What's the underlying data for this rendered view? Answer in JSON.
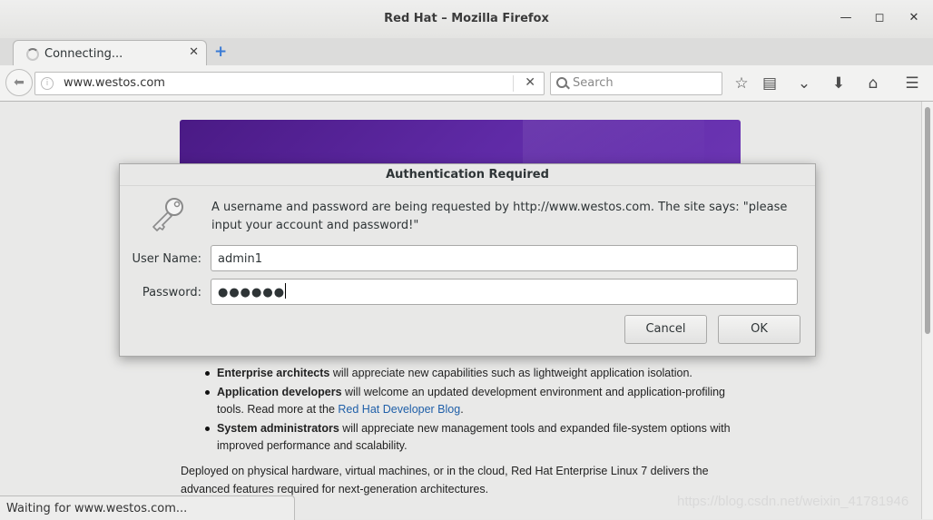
{
  "window": {
    "title": "Red Hat – Mozilla Firefox"
  },
  "tab": {
    "label": "Connecting..."
  },
  "navbar": {
    "url": "www.westos.com",
    "search_placeholder": "Search"
  },
  "page": {
    "items": [
      {
        "bold": "Enterprise architects",
        "text": " will appreciate new capabilities such as lightweight application isolation."
      },
      {
        "bold": "Application developers",
        "text": " will welcome an updated development environment and application-profiling tools. Read more at the ",
        "link": "Red Hat Developer Blog",
        "after": "."
      },
      {
        "bold": "System administrators",
        "text": " will appreciate new management tools and expanded file-system options with improved performance and scalability."
      }
    ],
    "paragraph": "Deployed on physical hardware, virtual machines, or in the cloud, Red Hat Enterprise Linux 7 delivers the advanced features required for next-generation architectures."
  },
  "status": "Waiting for www.westos.com...",
  "watermark": "https://blog.csdn.net/weixin_41781946",
  "dialog": {
    "title": "Authentication Required",
    "message": "A username and password are being requested by http://www.westos.com. The site says: \"please input your account and password!\"",
    "username_label": "User Name:",
    "username_value": "admin1",
    "password_label": "Password:",
    "password_mask": "●●●●●●",
    "cancel": "Cancel",
    "ok": "OK"
  },
  "icons": {
    "back": "back-arrow-icon",
    "info": "info-icon",
    "stop": "stop-icon",
    "search": "search-icon",
    "bookmark": "star-icon",
    "reading_list": "clipboard-icon",
    "pocket": "pocket-icon",
    "downloads": "download-icon",
    "home": "home-icon",
    "menu": "hamburger-menu-icon",
    "key": "key-icon"
  },
  "colors": {
    "banner": "#5f2aa6",
    "link": "#1f5fa8"
  }
}
